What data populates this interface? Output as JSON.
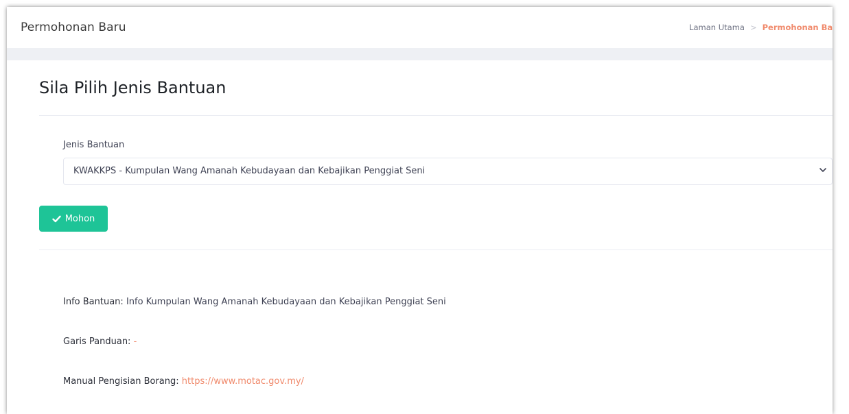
{
  "header": {
    "page_title": "Permohonan Baru",
    "breadcrumb_home": "Laman Utama",
    "breadcrumb_separator": ">",
    "breadcrumb_current": "Permohonan Baru"
  },
  "card": {
    "title": "Sila Pilih Jenis Bantuan",
    "field_label": "Jenis Bantuan",
    "select_value": "KWAKKPS - Kumpulan Wang Amanah Kebudayaan dan Kebajikan Penggiat Seni",
    "button_label": "Mohon",
    "button_icon": "check-icon"
  },
  "info": {
    "info_label": "Info Bantuan:",
    "info_value": "Info Kumpulan Wang Amanah Kebudayaan dan Kebajikan Penggiat Seni",
    "garis_label": "Garis Panduan:",
    "garis_value": "-",
    "manual_label": "Manual Pengisian Borang:",
    "manual_value": "https://www.motac.gov.my/"
  },
  "colors": {
    "accent_green": "#1ec497",
    "link_orange": "#f08a6c"
  }
}
